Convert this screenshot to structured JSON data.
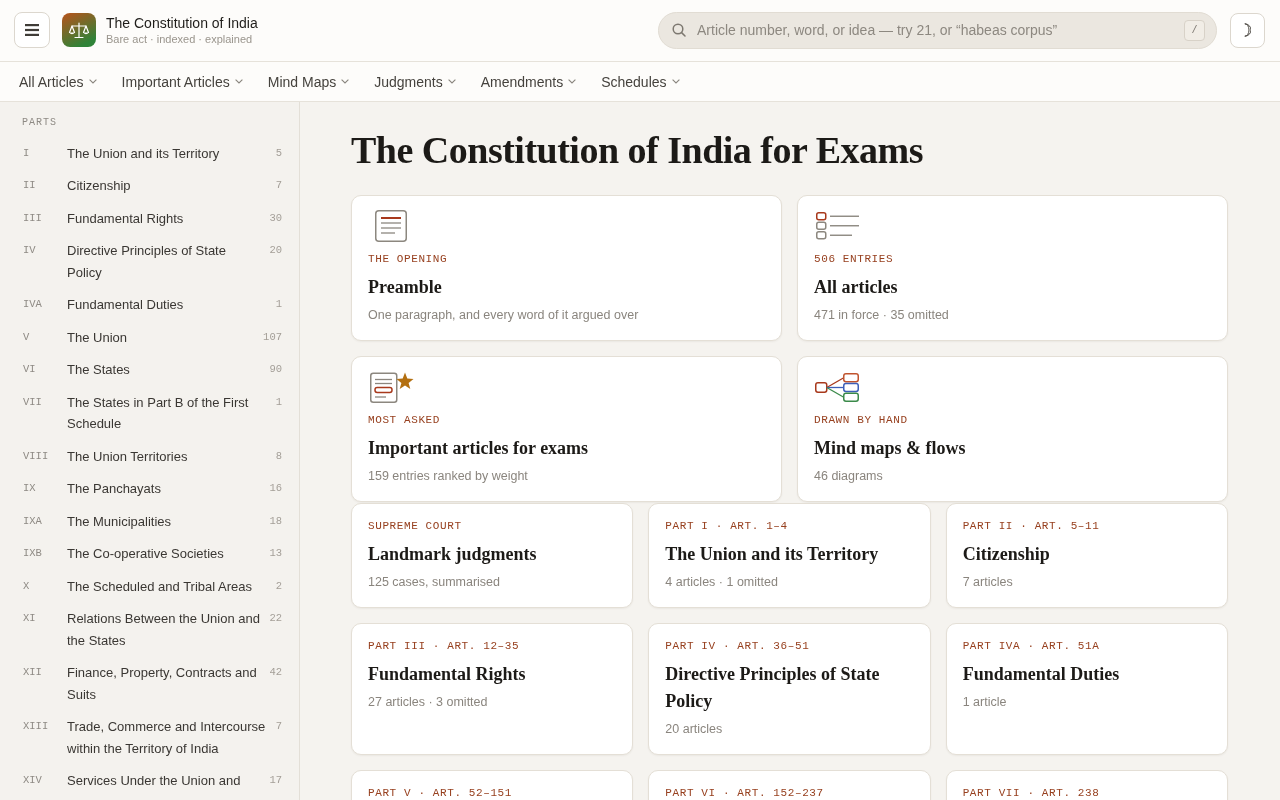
{
  "header": {
    "title": "The Constitution of India",
    "subtitle": "Bare act · indexed · explained",
    "search": {
      "placeholder": "Article number, word, or idea — try 21, or “habeas corpus”",
      "shortcut": "/"
    }
  },
  "nav": [
    {
      "label": "All Articles"
    },
    {
      "label": "Important Articles"
    },
    {
      "label": "Mind Maps"
    },
    {
      "label": "Judgments"
    },
    {
      "label": "Amendments"
    },
    {
      "label": "Schedules"
    }
  ],
  "sidebar": {
    "heading": "PARTS",
    "items": [
      {
        "numeral": "I",
        "title": "The Union and its Territory",
        "count": "5"
      },
      {
        "numeral": "II",
        "title": "Citizenship",
        "count": "7"
      },
      {
        "numeral": "III",
        "title": "Fundamental Rights",
        "count": "30"
      },
      {
        "numeral": "IV",
        "title": "Directive Principles of State Policy",
        "count": "20"
      },
      {
        "numeral": "IVA",
        "title": "Fundamental Duties",
        "count": "1"
      },
      {
        "numeral": "V",
        "title": "The Union",
        "count": "107"
      },
      {
        "numeral": "VI",
        "title": "The States",
        "count": "90"
      },
      {
        "numeral": "VII",
        "title": "The States in Part B of the First Schedule",
        "count": "1"
      },
      {
        "numeral": "VIII",
        "title": "The Union Territories",
        "count": "8"
      },
      {
        "numeral": "IX",
        "title": "The Panchayats",
        "count": "16"
      },
      {
        "numeral": "IXA",
        "title": "The Municipalities",
        "count": "18"
      },
      {
        "numeral": "IXB",
        "title": "The Co-operative Societies",
        "count": "13"
      },
      {
        "numeral": "X",
        "title": "The Scheduled and Tribal Areas",
        "count": "2"
      },
      {
        "numeral": "XI",
        "title": "Relations Between the Union and the States",
        "count": "22"
      },
      {
        "numeral": "XII",
        "title": "Finance, Property, Contracts and Suits",
        "count": "42"
      },
      {
        "numeral": "XIII",
        "title": "Trade, Commerce and Intercourse within the Territory of India",
        "count": "7"
      },
      {
        "numeral": "XIV",
        "title": "Services Under the Union and",
        "count": "17"
      }
    ]
  },
  "main": {
    "title": "The Constitution of India for Exams",
    "feature_cards": [
      {
        "kind": "preamble",
        "eyebrow": "THE OPENING",
        "title": "Preamble",
        "subtitle": "One paragraph, and every word of it argued over"
      },
      {
        "kind": "index",
        "eyebrow": "506 ENTRIES",
        "title": "All articles",
        "subtitle": "471 in force · 35 omitted"
      },
      {
        "kind": "important",
        "eyebrow": "MOST ASKED",
        "title": "Important articles for exams",
        "subtitle": "159 entries ranked by weight"
      },
      {
        "kind": "maps",
        "eyebrow": "DRAWN BY HAND",
        "title": "Mind maps & flows",
        "subtitle": "46 diagrams"
      }
    ],
    "part_cards": [
      {
        "eyebrow": "SUPREME COURT",
        "title": "Landmark judgments",
        "subtitle": "125 cases, summarised"
      },
      {
        "eyebrow": "PART I · ART. 1–4",
        "title": "The Union and its Territory",
        "subtitle": "4 articles · 1 omitted"
      },
      {
        "eyebrow": "PART II · ART. 5–11",
        "title": "Citizenship",
        "subtitle": "7 articles"
      },
      {
        "eyebrow": "PART III · ART. 12–35",
        "title": "Fundamental Rights",
        "subtitle": "27 articles · 3 omitted"
      },
      {
        "eyebrow": "PART IV · ART. 36–51",
        "title": "Directive Principles of State Policy",
        "subtitle": "20 articles"
      },
      {
        "eyebrow": "PART IVA · ART. 51A",
        "title": "Fundamental Duties",
        "subtitle": "1 article"
      },
      {
        "eyebrow": "PART V · ART. 52–151"
      },
      {
        "eyebrow": "PART VI · ART. 152–237"
      },
      {
        "eyebrow": "PART VII · ART. 238"
      }
    ]
  }
}
